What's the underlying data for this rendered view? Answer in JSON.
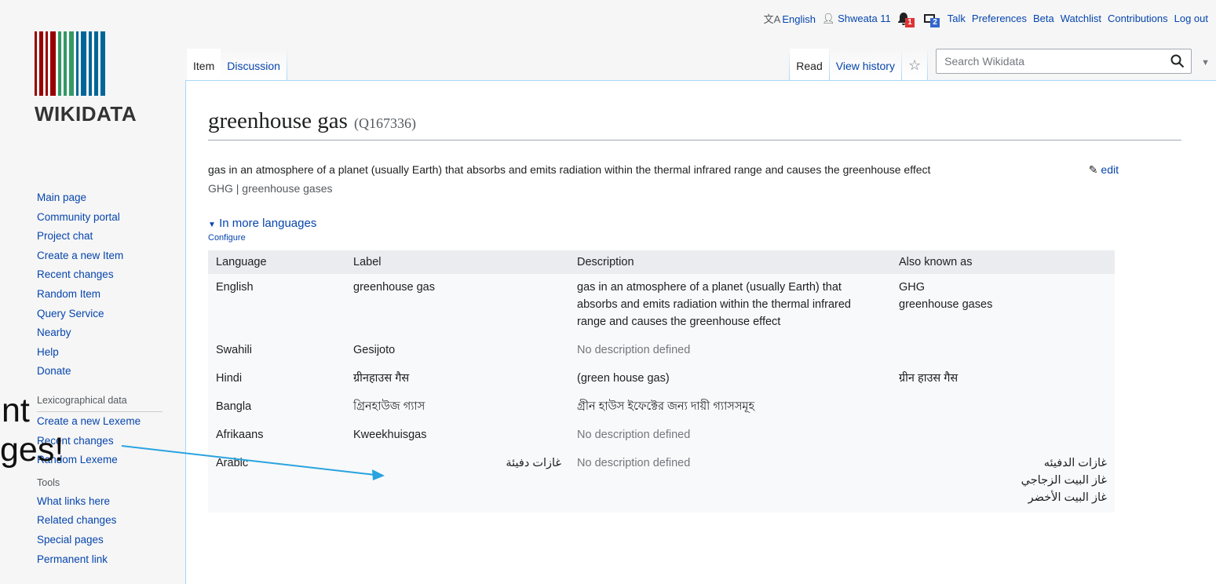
{
  "personal": {
    "language": "English",
    "username": "Shweata 11",
    "alerts_count": "1",
    "notices_count": "2",
    "links": [
      "Talk",
      "Preferences",
      "Beta",
      "Watchlist",
      "Contributions",
      "Log out"
    ]
  },
  "logo": {
    "wordmark": "WIKIDATA",
    "bar_colors": [
      "#990000",
      "#339966",
      "#006699"
    ]
  },
  "sidebar": {
    "nav": [
      "Main page",
      "Community portal",
      "Project chat",
      "Create a new Item",
      "Recent changes",
      "Random Item",
      "Query Service",
      "Nearby",
      "Help",
      "Donate"
    ],
    "lexico_heading": "Lexicographical data",
    "lexico": [
      "Create a new Lexeme",
      "Recent changes",
      "Random Lexeme"
    ],
    "tools_heading": "Tools",
    "tools": [
      "What links here",
      "Related changes",
      "Special pages",
      "Permanent link"
    ]
  },
  "tabs": {
    "item": "Item",
    "discussion": "Discussion",
    "read": "Read",
    "view_history": "View history"
  },
  "search": {
    "placeholder": "Search Wikidata"
  },
  "entity": {
    "label": "greenhouse gas",
    "qid": "(Q167336)",
    "description": "gas in an atmosphere of a planet (usually Earth) that absorbs and emits radiation within the thermal infrared range and causes the greenhouse effect",
    "edit": "edit",
    "aliases": "GHG | greenhouse gases"
  },
  "languages": {
    "toggle": "In more languages",
    "configure": "Configure",
    "headers": [
      "Language",
      "Label",
      "Description",
      "Also known as"
    ],
    "rows": [
      {
        "language": "English",
        "label": "greenhouse gas",
        "description": "gas in an atmosphere of a planet (usually Earth) that absorbs and emits radiation within the thermal infrared range and causes the greenhouse effect",
        "aliases": [
          "GHG",
          "greenhouse gases"
        ]
      },
      {
        "language": "Swahili",
        "label": "Gesijoto",
        "description": "No description defined",
        "aliases": []
      },
      {
        "language": "Hindi",
        "label": "ग्रीनहाउस गैस",
        "description": "(green house gas)",
        "aliases": [
          "ग्रीन हाउस गैस"
        ]
      },
      {
        "language": "Bangla",
        "label": "গ্রিনহাউজ গ্যাস",
        "description": "গ্রীন হাউস ইফেক্টের জন্য দায়ী গ্যাসসমূহ",
        "aliases": []
      },
      {
        "language": "Afrikaans",
        "label": "Kweekhuisgas",
        "description": "No description defined",
        "aliases": []
      },
      {
        "language": "Arabic",
        "label": "غازات دفيئة",
        "description": "No description defined",
        "aliases": [
          "غازات الدفيئه",
          "غاز البيت الزجاجي",
          "غاز البيت الأخضر"
        ]
      }
    ]
  },
  "overlay": {
    "line1": "nt",
    "line2": "ges!",
    "arrow_color": "#29a3e0"
  }
}
